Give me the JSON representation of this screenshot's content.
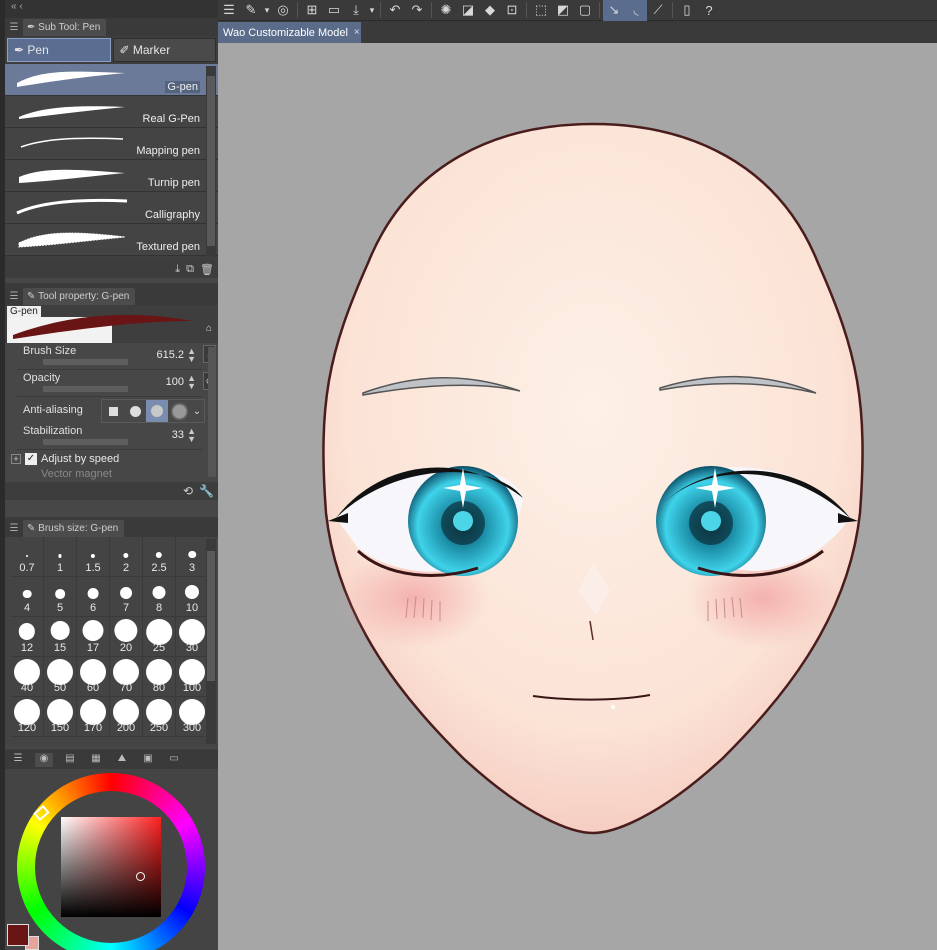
{
  "panel_top_mini": "«   ‹",
  "toolbar": {
    "icons": [
      "hamburger-icon",
      "eyedropper-icon",
      "chevron-down-icon",
      "spiral-icon",
      "new-file-icon",
      "open-folder-icon",
      "save-icon",
      "chevron-down-icon",
      "undo-icon",
      "redo-icon",
      "loading-icon",
      "clear-icon",
      "fill-icon",
      "transform-icon",
      "deselect-icon",
      "invert-select-icon",
      "select-icon",
      "pen-cursor-icon",
      "brush-cursor-icon",
      "ruler-icon",
      "phone-icon",
      "help-icon"
    ]
  },
  "document_tab": {
    "title": "Wao Customizable Model",
    "close": "×"
  },
  "subtool": {
    "header": "Sub Tool: Pen",
    "groups": [
      {
        "label": "Pen"
      },
      {
        "label": "Marker"
      }
    ],
    "brushes": [
      {
        "name": "G-pen"
      },
      {
        "name": "Real G-Pen"
      },
      {
        "name": "Mapping pen"
      },
      {
        "name": "Turnip pen"
      },
      {
        "name": "Calligraphy"
      },
      {
        "name": "Textured pen"
      }
    ]
  },
  "tool_property": {
    "header": "Tool property: G-pen",
    "preview_name": "G-pen",
    "brush_size_label": "Brush Size",
    "brush_size_value": "615.2",
    "opacity_label": "Opacity",
    "opacity_value": "100",
    "antialias_label": "Anti-aliasing",
    "antialias_selected": 2,
    "stabilization_label": "Stabilization",
    "stabilization_value": "33",
    "adjust_label": "Adjust by speed",
    "adjust_checked": true,
    "vector_label": "Vector magnet"
  },
  "brush_size": {
    "header": "Brush size: G-pen",
    "sizes": [
      "0.7",
      "1",
      "1.5",
      "2",
      "2.5",
      "3",
      "4",
      "5",
      "6",
      "7",
      "8",
      "10",
      "12",
      "15",
      "17",
      "20",
      "25",
      "30",
      "40",
      "50",
      "60",
      "70",
      "80",
      "100",
      "120",
      "150",
      "170",
      "200",
      "250",
      "300"
    ]
  },
  "color": {
    "main": "#6a1515",
    "sub": "#e7a49c"
  }
}
